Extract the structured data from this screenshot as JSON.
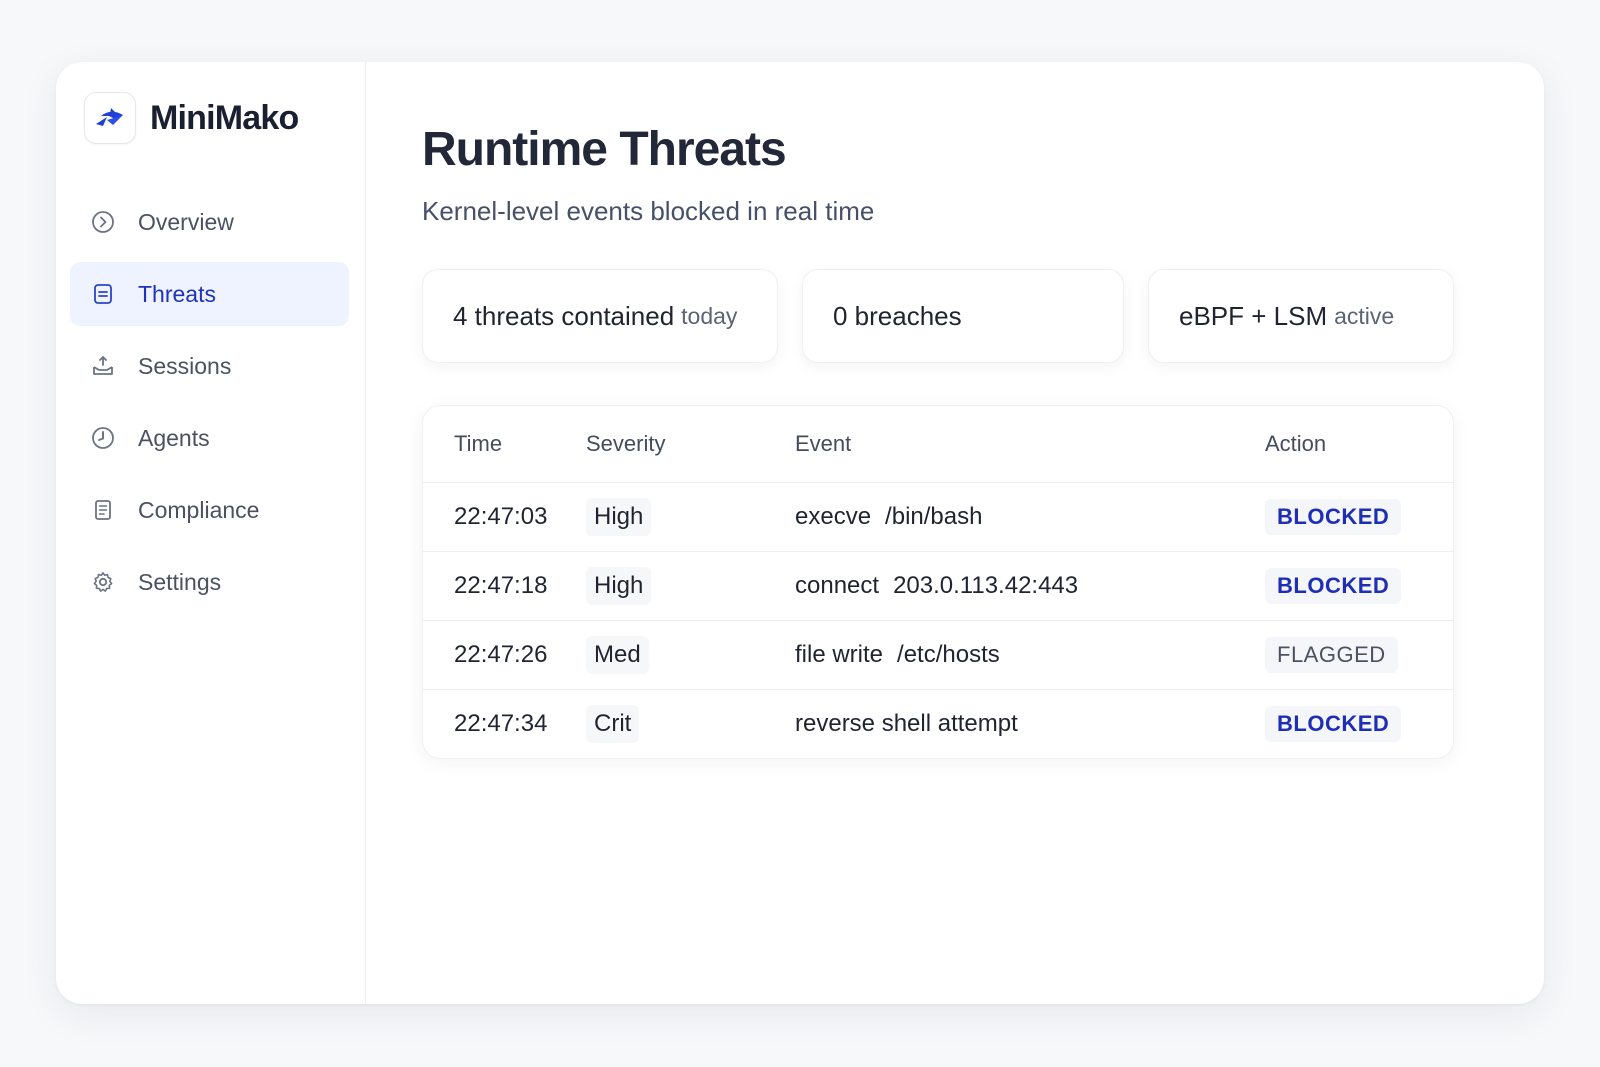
{
  "app": {
    "name": "MiniMako"
  },
  "sidebar": {
    "items": [
      {
        "label": "Overview",
        "icon": "chevron-circle-icon",
        "active": false
      },
      {
        "label": "Threats",
        "icon": "list-doc-icon",
        "active": true
      },
      {
        "label": "Sessions",
        "icon": "tray-upload-icon",
        "active": false
      },
      {
        "label": "Agents",
        "icon": "alert-clock-icon",
        "active": false
      },
      {
        "label": "Compliance",
        "icon": "document-icon",
        "active": false
      },
      {
        "label": "Settings",
        "icon": "gear-icon",
        "active": false
      }
    ]
  },
  "header": {
    "title": "Runtime Threats",
    "subtitle": "Kernel-level events blocked in real time"
  },
  "stats": [
    {
      "main": "4 threats contained",
      "muted": "today"
    },
    {
      "main": "0 breaches",
      "muted": ""
    },
    {
      "main": "eBPF + LSM",
      "muted": "active"
    }
  ],
  "table": {
    "columns": [
      "Time",
      "Severity",
      "Event",
      "Action"
    ],
    "rows": [
      {
        "time": "22:47:03",
        "severity": "High",
        "event_cmd": "execve",
        "event_arg": "/bin/bash",
        "action": "BLOCKED"
      },
      {
        "time": "22:47:18",
        "severity": "High",
        "event_cmd": "connect",
        "event_arg": "203.0.113.42:443",
        "action": "BLOCKED"
      },
      {
        "time": "22:47:26",
        "severity": "Med",
        "event_cmd": "file write",
        "event_arg": "/etc/hosts",
        "action": "FLAGGED"
      },
      {
        "time": "22:47:34",
        "severity": "Crit",
        "event_cmd": "reverse shell attempt",
        "event_arg": "",
        "action": "BLOCKED"
      }
    ]
  },
  "colors": {
    "accent": "#1e2fb6",
    "active_bg": "#eef3ff",
    "badge_bg": "#f5f6f9"
  }
}
